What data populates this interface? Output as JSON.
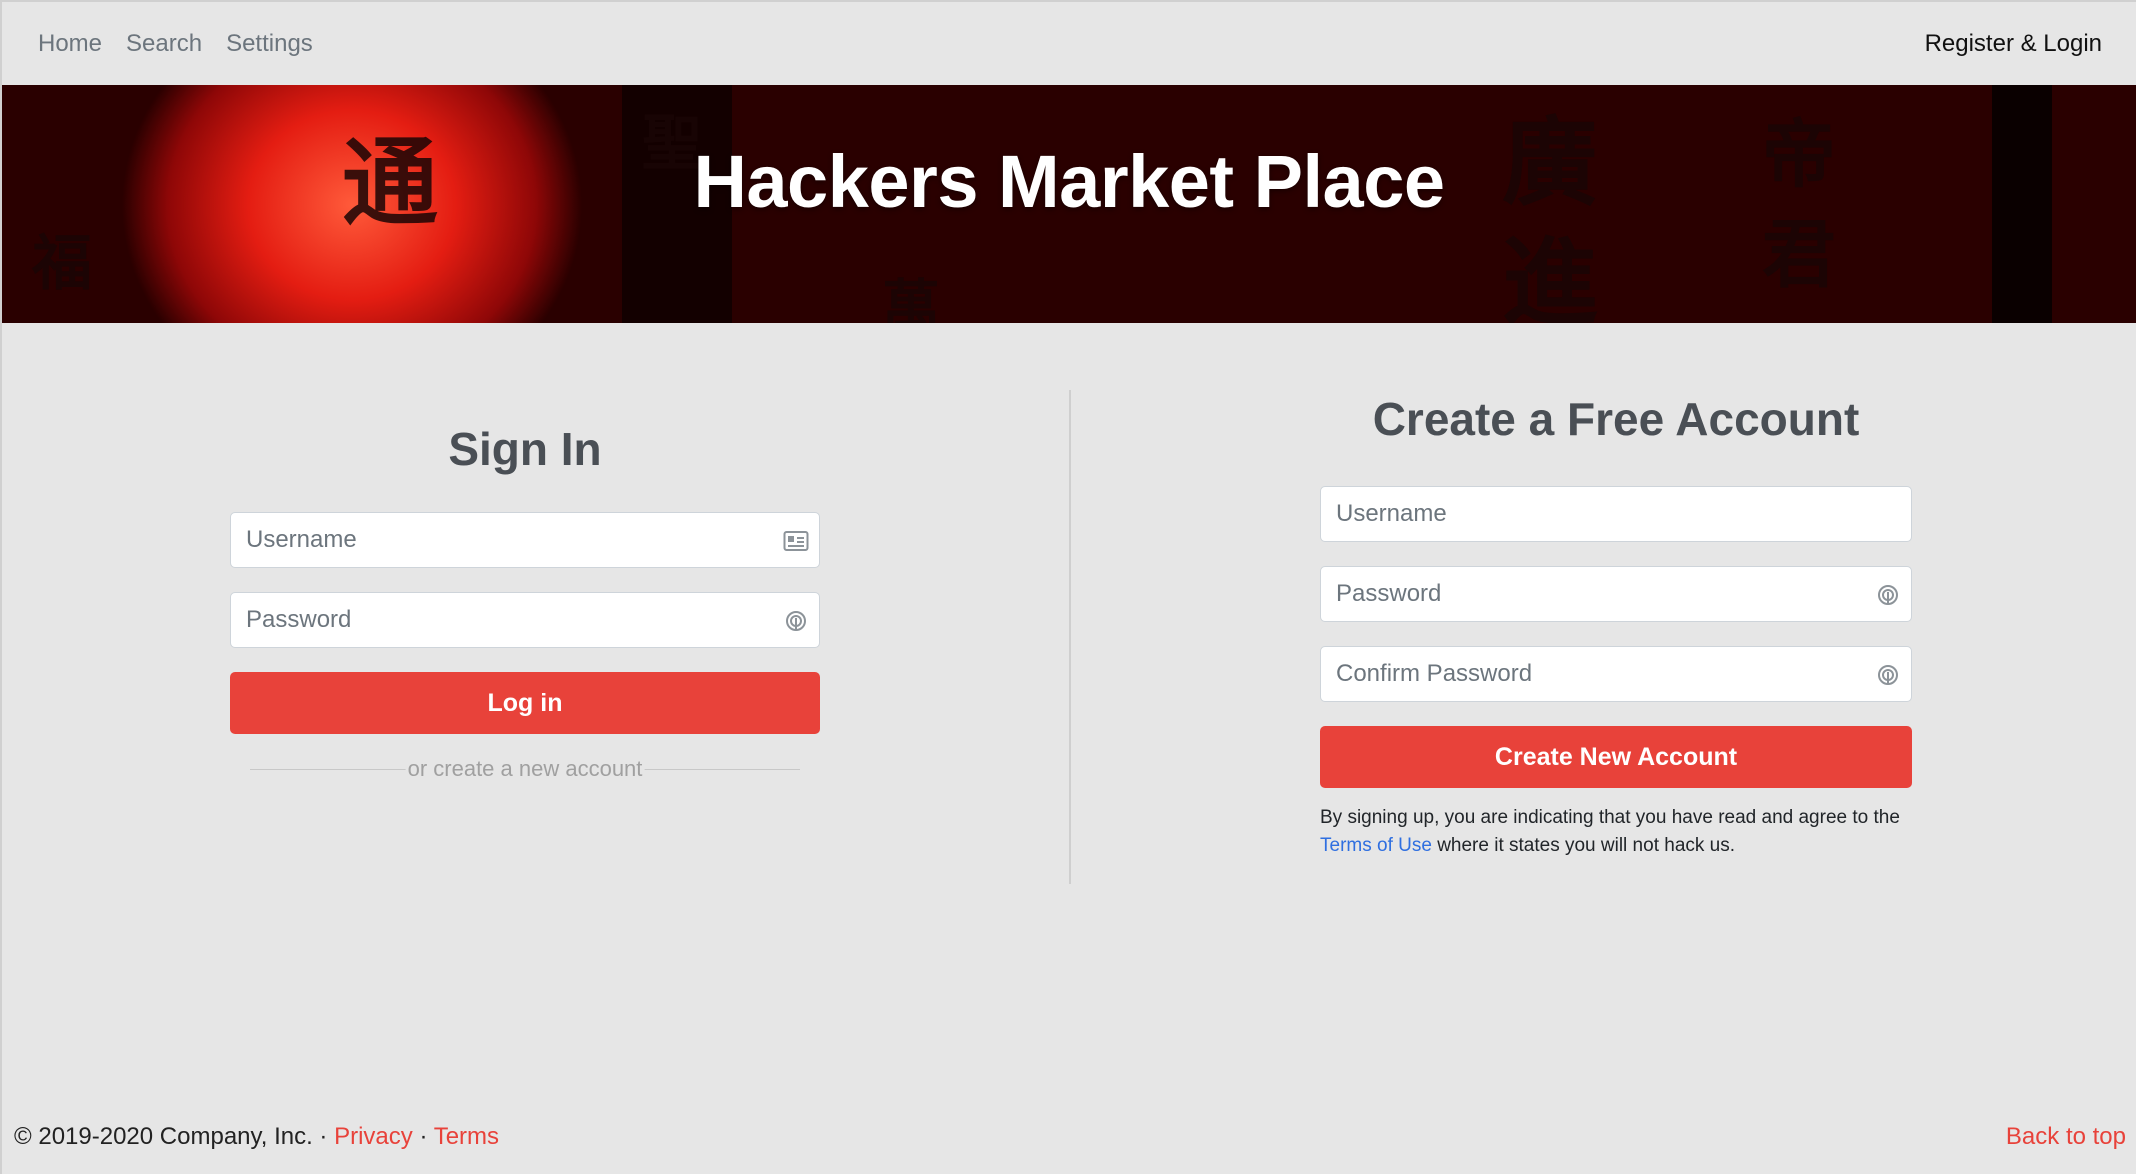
{
  "nav": {
    "links": [
      "Home",
      "Search",
      "Settings"
    ],
    "register_login": "Register & Login"
  },
  "banner": {
    "title": "Hackers Market Place"
  },
  "signin": {
    "heading": "Sign In",
    "username_placeholder": "Username",
    "password_placeholder": "Password",
    "login_button": "Log in",
    "create_link": "or create a new account"
  },
  "signup": {
    "heading": "Create a Free Account",
    "username_placeholder": "Username",
    "password_placeholder": "Password",
    "confirm_placeholder": "Confirm Password",
    "create_button": "Create New Account",
    "terms_prefix": "By signing up, you are indicating that you have read and agree to the",
    "terms_link": "Terms of Use",
    "terms_suffix": "where it states you will not hack us."
  },
  "footer": {
    "copyright": "© 2019-2020 Company, Inc.",
    "separator": "·",
    "privacy": "Privacy",
    "terms": "Terms",
    "back_to_top": "Back to top"
  },
  "icons": {
    "id_card": "id-card-icon",
    "fingerprint": "fingerprint-icon"
  },
  "colors": {
    "accent": "#e8423a",
    "link": "#2f6fe0",
    "background": "#e6e6e6"
  }
}
